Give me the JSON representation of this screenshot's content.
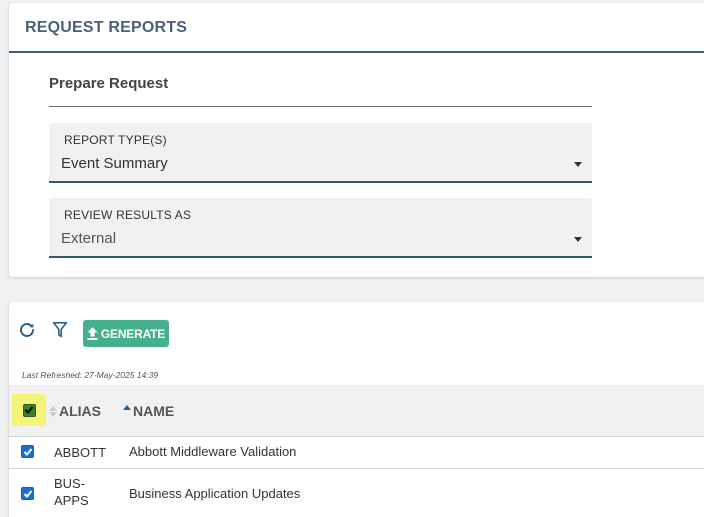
{
  "request_card": {
    "title": "REQUEST REPORTS",
    "section_title": "Prepare Request",
    "report_type": {
      "label": "REPORT TYPE(S)",
      "value": "Event Summary"
    },
    "review_results": {
      "label": "REVIEW RESULTS AS",
      "value": "External"
    }
  },
  "results_card": {
    "toolbar": {
      "refresh_icon": "refresh-icon",
      "filter_icon": "filter-icon",
      "generate_label": "GENERATE",
      "generate_icon": "upload-icon"
    },
    "last_refreshed": "Last Refreshed: 27-May-2025 14:39",
    "table": {
      "select_all_checked": true,
      "columns": [
        {
          "label": "ALIAS",
          "sort": "none"
        },
        {
          "label": "NAME",
          "sort": "ascending"
        }
      ],
      "rows": [
        {
          "checked": true,
          "alias": "ABBOTT",
          "name": "Abbott Middleware Validation"
        },
        {
          "checked": true,
          "alias": "BUS-APPS",
          "name": "Business Application Updates"
        }
      ]
    }
  },
  "colors": {
    "accent_navy": "#3d5a70",
    "title_text": "#4a6078",
    "generate_green": "#45b08c",
    "select_all_highlight": "#f4f47a",
    "checkbox_blue": "#1a6fd6",
    "checkbox_green": "#3a7d2a"
  }
}
